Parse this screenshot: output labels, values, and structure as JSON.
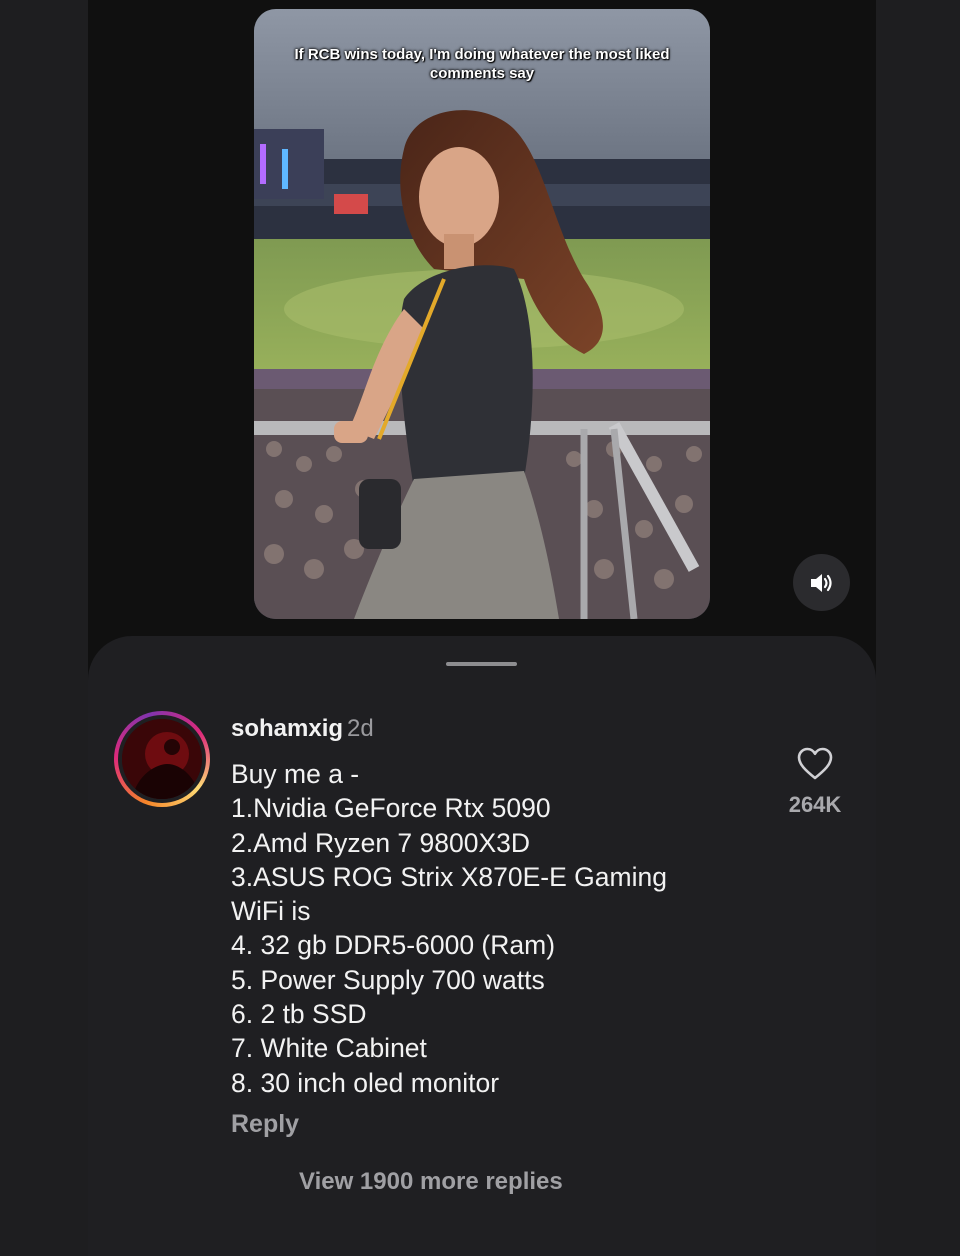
{
  "video": {
    "caption": "If RCB wins today, I'm doing whatever the most liked comments say",
    "sound_icon": "speaker-icon"
  },
  "comment": {
    "username": "sohamxig",
    "time": "2d",
    "lines": [
      "Buy me a -",
      "1.Nvidia GeForce Rtx 5090",
      "2.Amd Ryzen 7 9800X3D",
      "3.ASUS ROG Strix X870E-E Gaming",
      "WiFi is",
      "4. 32 gb DDR5-6000 (Ram)",
      "5. Power Supply 700 watts",
      "6. 2 tb SSD",
      "7. White Cabinet",
      "8. 30 inch oled monitor"
    ],
    "like_count": "264K",
    "like_icon": "heart-icon",
    "reply_label": "Reply",
    "view_replies_label": "View 1900 more replies"
  },
  "colors": {
    "background": "#1e1e20",
    "sheet": "#1f1f22",
    "text": "#f2f2f2",
    "muted": "#a0a0a4"
  }
}
